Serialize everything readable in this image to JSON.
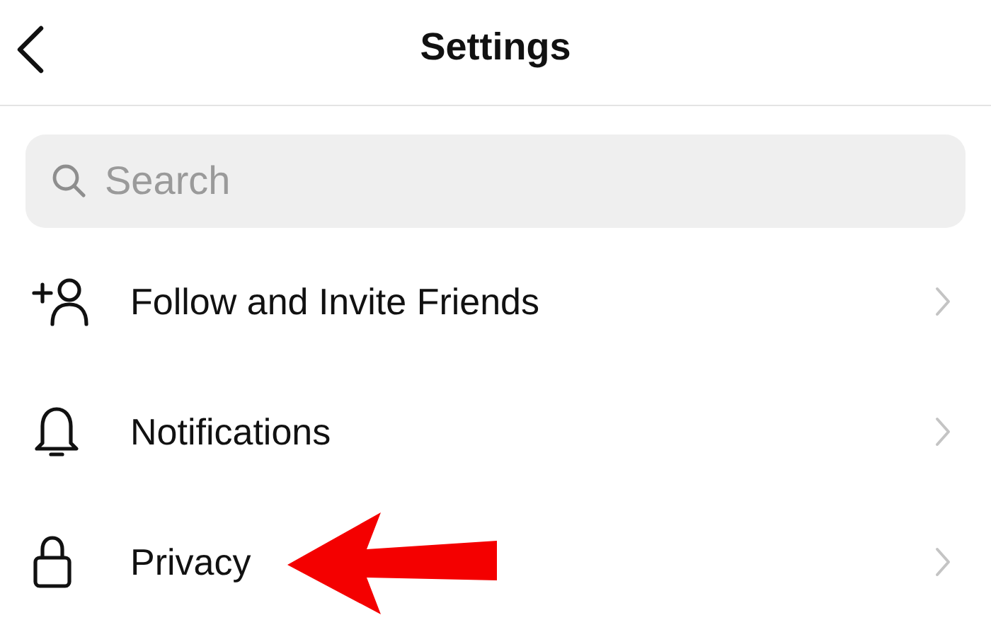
{
  "header": {
    "title": "Settings"
  },
  "search": {
    "placeholder": "Search"
  },
  "items": [
    {
      "kind": "invite",
      "label": "Follow and Invite Friends"
    },
    {
      "kind": "notifications",
      "label": "Notifications"
    },
    {
      "kind": "privacy",
      "label": "Privacy"
    }
  ]
}
